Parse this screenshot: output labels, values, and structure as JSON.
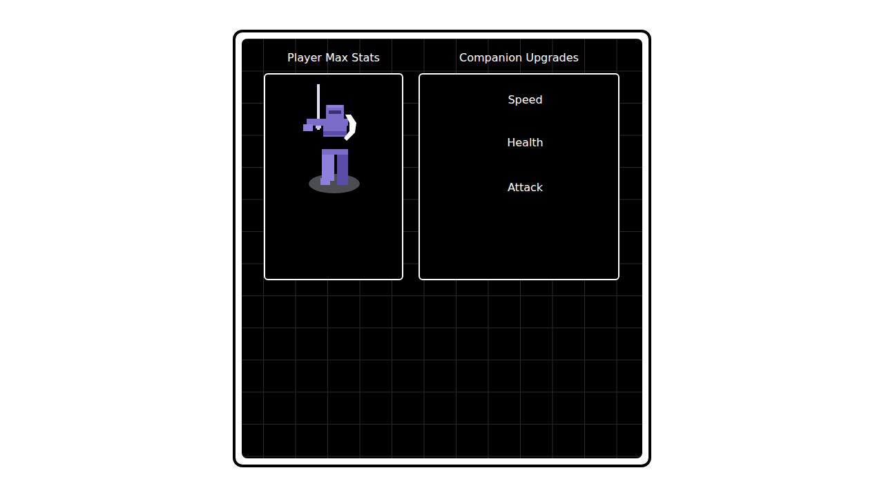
{
  "panels": [
    {
      "title": "Player Max Stats",
      "kind": "portrait"
    },
    {
      "title": "Companion Upgrades",
      "kind": "list",
      "items": [
        "Speed",
        "Health",
        "Attack"
      ]
    }
  ]
}
